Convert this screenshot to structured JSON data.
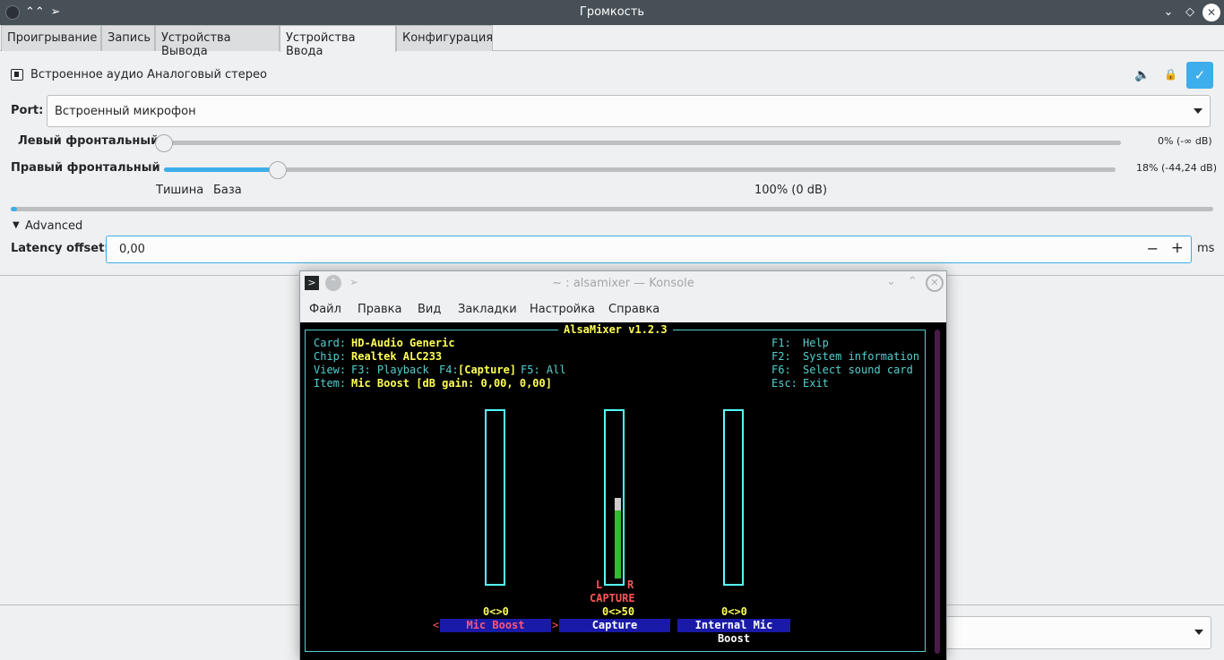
{
  "window": {
    "title": "Громкость"
  },
  "tabs": [
    "Проигрывание",
    "Запись",
    "Устройства Вывода",
    "Устройства Ввода",
    "Конфигурация"
  ],
  "device": {
    "name": "Встроенное аудио Аналоговый стерео",
    "port_label": "Port:",
    "port_value": "Встроенный микрофон"
  },
  "channels": [
    {
      "name": "Левый фронтальный",
      "value_text": "0% (-∞ dB)",
      "level": 0.0
    },
    {
      "name": "Правый фронтальный",
      "value_text": "18% (-44,24 dB)",
      "level": 0.18
    }
  ],
  "scale": {
    "silence": "Тишина",
    "base": "База",
    "full": "100% (0 dB)"
  },
  "advanced": {
    "label": "Advanced",
    "latency_label": "Latency offset:",
    "latency_value": "0,00",
    "latency_unit": "ms",
    "minus": "−",
    "plus": "+"
  },
  "icons": {
    "check": "✓"
  },
  "konsole": {
    "title": "~ : alsamixer — Konsole",
    "menu": [
      "Файл",
      "Правка",
      "Вид",
      "Закладки",
      "Настройка",
      "Справка"
    ],
    "alsamixer": {
      "header": "AlsaMixer v1.2.3",
      "card_label": "Card:",
      "card": "HD-Audio Generic",
      "chip_label": "Chip:",
      "chip": "Realtek ALC233",
      "view_label": "View:",
      "view_f3": "F3: Playback",
      "view_f4_key": "F4:",
      "view_f4": "[Capture]",
      "view_f5": "F5: All",
      "item_label": "Item:",
      "item": "Mic Boost [dB gain: 0,00, 0,00]",
      "help": [
        {
          "key": "F1:",
          "text": "Help"
        },
        {
          "key": "F2:",
          "text": "System information"
        },
        {
          "key": "F6:",
          "text": "Select sound card"
        },
        {
          "key": "Esc:",
          "text": "Exit"
        }
      ],
      "controls": [
        {
          "name": "Mic Boost",
          "value": "0<>0",
          "level": 0
        },
        {
          "name": "Capture",
          "value": "0<>50",
          "level": 0.5,
          "l": "L",
          "r": "R",
          "tag": "CAPTURE"
        },
        {
          "name": "Internal Mic Boost",
          "value": "0<>0",
          "level": 0
        }
      ]
    }
  }
}
